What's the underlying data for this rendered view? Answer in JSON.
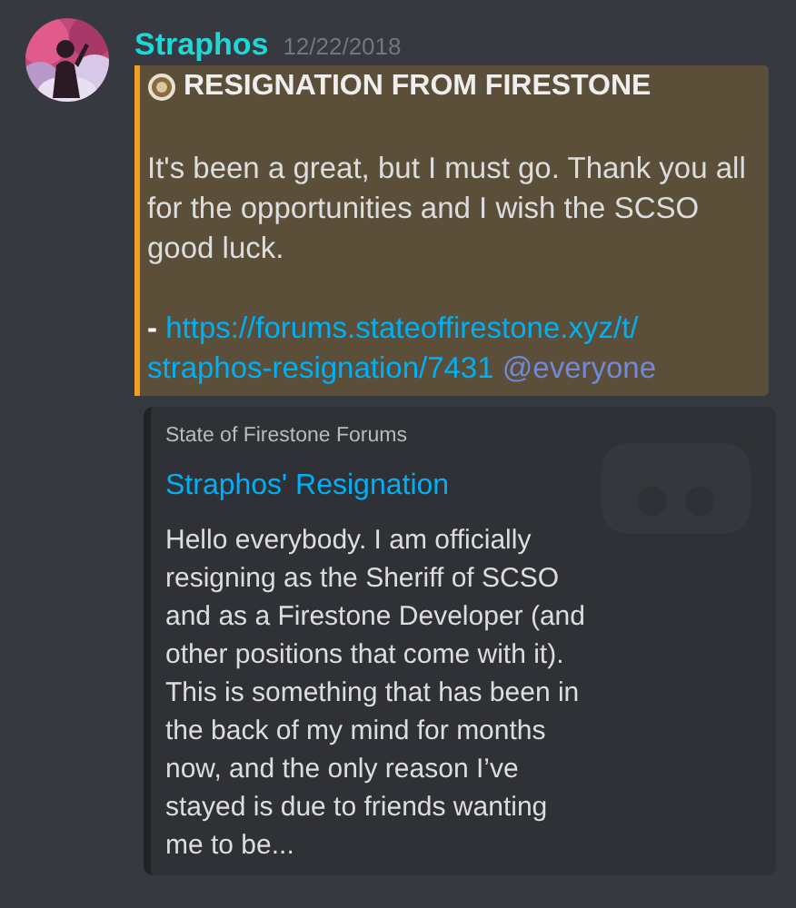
{
  "message": {
    "author": "Straphos",
    "timestamp": "12/22/2018",
    "quote": {
      "title": "RESIGNATION FROM FIRESTONE",
      "body": "It's been a great, but I must go. Thank you all for the opportunities and I wish the SCSO good luck.",
      "dash": "-",
      "link_lines": [
        "https://forums.stateoffirestone.xyz/t/",
        "straphos-resignation/7431"
      ],
      "mention": "@everyone"
    },
    "embed": {
      "provider": "State of Firestone Forums",
      "title": "Straphos' Resignation",
      "description": "Hello everybody.  I am officially resigning as the Sheriff of SCSO and as a Firestone Developer (and other positions that come with it). This is something that has been in the back of my mind for months now, and the only reason I’ve stayed is due to friends wanting me to be..."
    }
  }
}
